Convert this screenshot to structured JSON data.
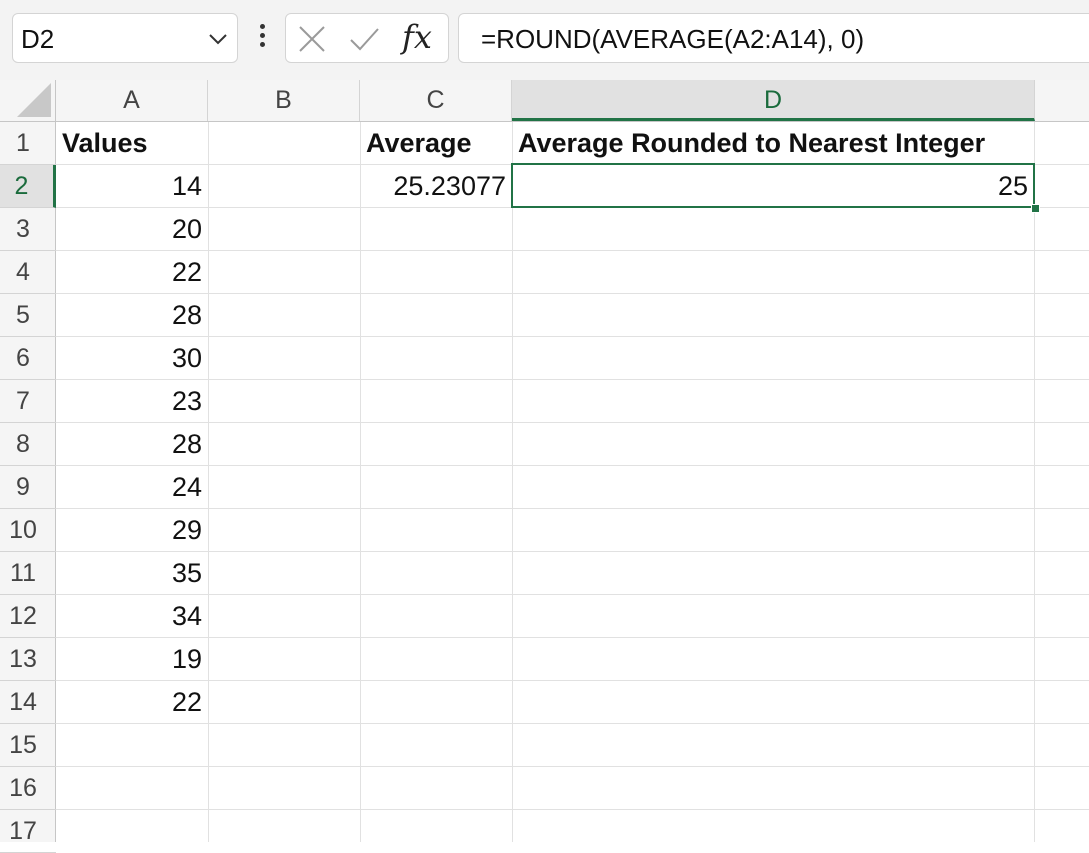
{
  "formula_bar": {
    "name_box": "D2",
    "formula": "=ROUND(AVERAGE(A2:A14), 0)",
    "fx_label": "fx"
  },
  "columns": [
    "A",
    "B",
    "C",
    "D"
  ],
  "rows": [
    "1",
    "2",
    "3",
    "4",
    "5",
    "6",
    "7",
    "8",
    "9",
    "10",
    "11",
    "12",
    "13",
    "14",
    "15",
    "16",
    "17"
  ],
  "cells": {
    "a1": "Values",
    "c1": "Average",
    "d1": "Average Rounded to Nearest Integer",
    "c2": "25.23077",
    "d2": "25",
    "values": [
      "14",
      "20",
      "22",
      "28",
      "30",
      "23",
      "28",
      "24",
      "29",
      "35",
      "34",
      "19",
      "22"
    ]
  },
  "selection": {
    "cell": "D2",
    "accent_color": "#217346"
  },
  "icons": {
    "name_box_dropdown": "chevron-down-icon",
    "more": "more-vertical-icon",
    "cancel": "close-icon",
    "enter": "check-icon",
    "insert_function": "function-icon"
  }
}
